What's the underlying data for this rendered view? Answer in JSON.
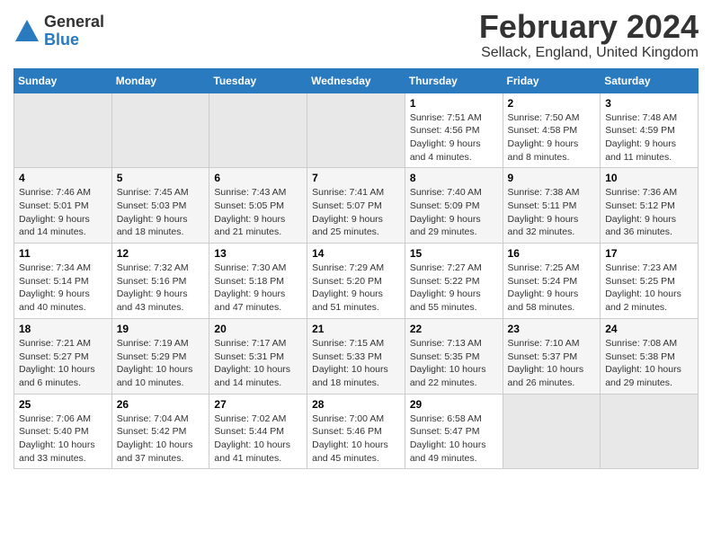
{
  "logo": {
    "general": "General",
    "blue": "Blue"
  },
  "title": {
    "month_year": "February 2024",
    "location": "Sellack, England, United Kingdom"
  },
  "weekdays": [
    "Sunday",
    "Monday",
    "Tuesday",
    "Wednesday",
    "Thursday",
    "Friday",
    "Saturday"
  ],
  "weeks": [
    [
      {
        "day": "",
        "info": ""
      },
      {
        "day": "",
        "info": ""
      },
      {
        "day": "",
        "info": ""
      },
      {
        "day": "",
        "info": ""
      },
      {
        "day": "1",
        "info": "Sunrise: 7:51 AM\nSunset: 4:56 PM\nDaylight: 9 hours\nand 4 minutes."
      },
      {
        "day": "2",
        "info": "Sunrise: 7:50 AM\nSunset: 4:58 PM\nDaylight: 9 hours\nand 8 minutes."
      },
      {
        "day": "3",
        "info": "Sunrise: 7:48 AM\nSunset: 4:59 PM\nDaylight: 9 hours\nand 11 minutes."
      }
    ],
    [
      {
        "day": "4",
        "info": "Sunrise: 7:46 AM\nSunset: 5:01 PM\nDaylight: 9 hours\nand 14 minutes."
      },
      {
        "day": "5",
        "info": "Sunrise: 7:45 AM\nSunset: 5:03 PM\nDaylight: 9 hours\nand 18 minutes."
      },
      {
        "day": "6",
        "info": "Sunrise: 7:43 AM\nSunset: 5:05 PM\nDaylight: 9 hours\nand 21 minutes."
      },
      {
        "day": "7",
        "info": "Sunrise: 7:41 AM\nSunset: 5:07 PM\nDaylight: 9 hours\nand 25 minutes."
      },
      {
        "day": "8",
        "info": "Sunrise: 7:40 AM\nSunset: 5:09 PM\nDaylight: 9 hours\nand 29 minutes."
      },
      {
        "day": "9",
        "info": "Sunrise: 7:38 AM\nSunset: 5:11 PM\nDaylight: 9 hours\nand 32 minutes."
      },
      {
        "day": "10",
        "info": "Sunrise: 7:36 AM\nSunset: 5:12 PM\nDaylight: 9 hours\nand 36 minutes."
      }
    ],
    [
      {
        "day": "11",
        "info": "Sunrise: 7:34 AM\nSunset: 5:14 PM\nDaylight: 9 hours\nand 40 minutes."
      },
      {
        "day": "12",
        "info": "Sunrise: 7:32 AM\nSunset: 5:16 PM\nDaylight: 9 hours\nand 43 minutes."
      },
      {
        "day": "13",
        "info": "Sunrise: 7:30 AM\nSunset: 5:18 PM\nDaylight: 9 hours\nand 47 minutes."
      },
      {
        "day": "14",
        "info": "Sunrise: 7:29 AM\nSunset: 5:20 PM\nDaylight: 9 hours\nand 51 minutes."
      },
      {
        "day": "15",
        "info": "Sunrise: 7:27 AM\nSunset: 5:22 PM\nDaylight: 9 hours\nand 55 minutes."
      },
      {
        "day": "16",
        "info": "Sunrise: 7:25 AM\nSunset: 5:24 PM\nDaylight: 9 hours\nand 58 minutes."
      },
      {
        "day": "17",
        "info": "Sunrise: 7:23 AM\nSunset: 5:25 PM\nDaylight: 10 hours\nand 2 minutes."
      }
    ],
    [
      {
        "day": "18",
        "info": "Sunrise: 7:21 AM\nSunset: 5:27 PM\nDaylight: 10 hours\nand 6 minutes."
      },
      {
        "day": "19",
        "info": "Sunrise: 7:19 AM\nSunset: 5:29 PM\nDaylight: 10 hours\nand 10 minutes."
      },
      {
        "day": "20",
        "info": "Sunrise: 7:17 AM\nSunset: 5:31 PM\nDaylight: 10 hours\nand 14 minutes."
      },
      {
        "day": "21",
        "info": "Sunrise: 7:15 AM\nSunset: 5:33 PM\nDaylight: 10 hours\nand 18 minutes."
      },
      {
        "day": "22",
        "info": "Sunrise: 7:13 AM\nSunset: 5:35 PM\nDaylight: 10 hours\nand 22 minutes."
      },
      {
        "day": "23",
        "info": "Sunrise: 7:10 AM\nSunset: 5:37 PM\nDaylight: 10 hours\nand 26 minutes."
      },
      {
        "day": "24",
        "info": "Sunrise: 7:08 AM\nSunset: 5:38 PM\nDaylight: 10 hours\nand 29 minutes."
      }
    ],
    [
      {
        "day": "25",
        "info": "Sunrise: 7:06 AM\nSunset: 5:40 PM\nDaylight: 10 hours\nand 33 minutes."
      },
      {
        "day": "26",
        "info": "Sunrise: 7:04 AM\nSunset: 5:42 PM\nDaylight: 10 hours\nand 37 minutes."
      },
      {
        "day": "27",
        "info": "Sunrise: 7:02 AM\nSunset: 5:44 PM\nDaylight: 10 hours\nand 41 minutes."
      },
      {
        "day": "28",
        "info": "Sunrise: 7:00 AM\nSunset: 5:46 PM\nDaylight: 10 hours\nand 45 minutes."
      },
      {
        "day": "29",
        "info": "Sunrise: 6:58 AM\nSunset: 5:47 PM\nDaylight: 10 hours\nand 49 minutes."
      },
      {
        "day": "",
        "info": ""
      },
      {
        "day": "",
        "info": ""
      }
    ]
  ]
}
